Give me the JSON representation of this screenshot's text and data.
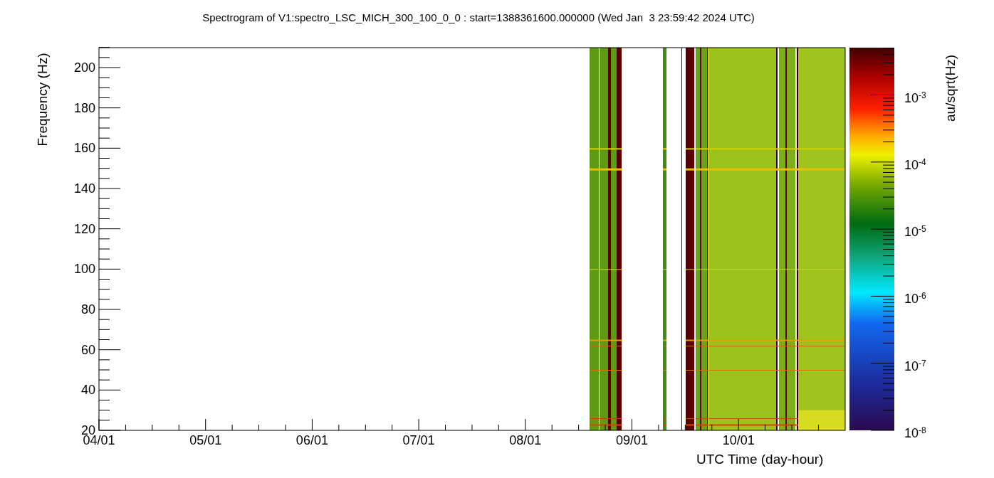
{
  "title": "Spectrogram of V1:spectro_LSC_MICH_300_100_0_0 : start=1388361600.000000 (Wed Jan  3 23:59:42 2024 UTC)",
  "y_axis": {
    "label": "Frequency (Hz)",
    "ticks": [
      "200",
      "180",
      "160",
      "140",
      "120",
      "100",
      "80",
      "60",
      "40",
      "20"
    ]
  },
  "x_axis": {
    "label": "UTC Time (day-hour)",
    "ticks": [
      "04/01",
      "05/01",
      "06/01",
      "07/01",
      "08/01",
      "09/01",
      "10/01"
    ]
  },
  "colorbar": {
    "label": "au/sqrt(Hz)",
    "ticks": [
      "10$^{-3}$",
      "10$^{-4}$",
      "10$^{-5}$",
      "10$^{-6}$",
      "10$^{-7}$",
      "10$^{-8}$"
    ]
  }
}
